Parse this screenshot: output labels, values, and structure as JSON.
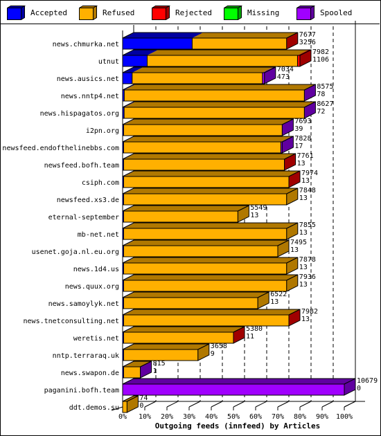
{
  "chart_data": {
    "type": "bar",
    "orientation": "horizontal",
    "stacked": "percent",
    "title": "",
    "xlabel": "Outgoing feeds (innfeed) by Articles",
    "ylabel": "",
    "xlim": [
      0,
      100
    ],
    "x_ticks": [
      "0%",
      "10%",
      "20%",
      "30%",
      "40%",
      "50%",
      "60%",
      "70%",
      "80%",
      "90%",
      "100%"
    ],
    "grid": true,
    "legend_position": "top",
    "legend": [
      {
        "name": "Accepted",
        "color": "#0000ff",
        "side": "#0000a0"
      },
      {
        "name": "Refused",
        "color": "#ffb000",
        "side": "#b07800"
      },
      {
        "name": "Rejected",
        "color": "#ff0000",
        "side": "#a00000"
      },
      {
        "name": "Missing",
        "color": "#00ff00",
        "side": "#00a000"
      },
      {
        "name": "Spooled",
        "color": "#a000ff",
        "side": "#6000a0"
      }
    ],
    "categories": [
      "news.chmurka.net",
      "utnut",
      "news.ausics.net",
      "news.nntp4.net",
      "news.hispagatos.org",
      "i2pn.org",
      "newsfeed.endofthelinebbs.com",
      "newsfeed.bofh.team",
      "csiph.com",
      "newsfeed.xs3.de",
      "eternal-september",
      "mb-net.net",
      "usenet.goja.nl.eu.org",
      "news.1d4.us",
      "news.quux.org",
      "news.samoylyk.net",
      "news.tnetconsulting.net",
      "weretis.net",
      "nntp.terraraq.uk",
      "news.swapon.de",
      "paganini.bofh.team",
      "ddt.demos.su"
    ],
    "totals": [
      7677,
      7982,
      7034,
      8575,
      8627,
      7693,
      7828,
      7761,
      7974,
      7848,
      5549,
      7855,
      7495,
      7878,
      7936,
      6522,
      7982,
      5380,
      3658,
      815,
      10679,
      74
    ],
    "accepted_labels": [
      3256,
      1106,
      473,
      78,
      72,
      39,
      17,
      13,
      13,
      13,
      13,
      13,
      13,
      13,
      13,
      13,
      13,
      11,
      9,
      1,
      0,
      0
    ],
    "series": [
      {
        "name": "Accepted",
        "values": [
          3256,
          1106,
          473,
          78,
          72,
          39,
          17,
          13,
          13,
          13,
          13,
          13,
          13,
          13,
          13,
          13,
          13,
          11,
          9,
          1,
          0,
          0
        ]
      },
      {
        "name": "Refused",
        "values": [
          4421,
          6766,
          6461,
          8497,
          8555,
          7654,
          7711,
          7748,
          7961,
          7835,
          5536,
          7842,
          7482,
          7865,
          7923,
          6509,
          7969,
          5369,
          3649,
          814,
          0,
          74
        ]
      },
      {
        "name": "Rejected",
        "values": [
          0,
          110,
          0,
          0,
          0,
          0,
          0,
          0,
          0,
          0,
          0,
          0,
          0,
          0,
          0,
          0,
          0,
          0,
          0,
          0,
          0,
          0
        ]
      },
      {
        "name": "Missing",
        "values": [
          0,
          0,
          0,
          0,
          0,
          0,
          0,
          0,
          0,
          0,
          0,
          0,
          0,
          0,
          0,
          0,
          0,
          0,
          0,
          0,
          0,
          0
        ]
      },
      {
        "name": "Spooled",
        "values": [
          0,
          0,
          100,
          0,
          0,
          0,
          100,
          0,
          0,
          0,
          0,
          0,
          0,
          0,
          0,
          0,
          0,
          0,
          0,
          0,
          10679,
          0
        ]
      }
    ],
    "side_face_series": [
      "Rejected",
      "Rejected",
      "Spooled",
      "Spooled",
      "Spooled",
      "Spooled",
      "Spooled",
      "Rejected",
      "Rejected",
      "Refused",
      "Refused",
      "Refused",
      "Refused",
      "Refused",
      "Refused",
      "Refused",
      "Rejected",
      "Rejected",
      "Refused",
      "Spooled",
      "Spooled",
      "Refused"
    ],
    "bar_extent_percent_of_max": [
      74,
      80,
      64,
      82,
      82,
      72,
      72,
      73,
      75,
      74,
      52,
      74,
      70,
      74,
      74,
      61,
      75,
      50,
      34,
      8,
      100,
      2
    ]
  }
}
